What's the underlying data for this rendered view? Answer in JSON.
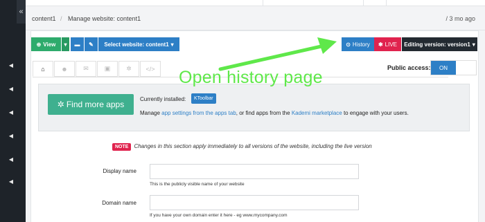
{
  "breadcrumb": {
    "item1": "content1",
    "sep": "/",
    "item2": "Manage website: content1"
  },
  "time": "/ 3 mo ago",
  "toolbar": {
    "view": "View",
    "select_site": "Select website: content1",
    "history": "History",
    "live": "LIVE",
    "editing": "Editing version: version1"
  },
  "public_access": {
    "label": "Public access:",
    "state": "ON"
  },
  "apps": {
    "find_button": "Find more apps",
    "installed_label": "Currently installed:",
    "installed_app": "KToolbar",
    "manage_prefix": "Manage ",
    "manage_link1": "app settings from the apps tab",
    "manage_mid": ", or find apps from the ",
    "manage_link2": "Kademi marketplace",
    "manage_suffix": " to engage with your users."
  },
  "note": {
    "badge": "NOTE",
    "text": "Changes in this section apply immediately to all versions of the website, including the live version"
  },
  "fields": {
    "display_name": {
      "label": "Display name",
      "value": "",
      "help": "This is the publicly visible name of your website"
    },
    "domain_name": {
      "label": "Domain name",
      "value": "",
      "help": "If you have your own domain enter it here - eg www.mycompany.com"
    }
  },
  "annotation": "Open history page",
  "colors": {
    "accent_blue": "#2d7fc6",
    "green": "#2eab6c",
    "live_red": "#e0234e",
    "annotation_green": "#5fe84a",
    "sidebar": "#1e2329"
  }
}
